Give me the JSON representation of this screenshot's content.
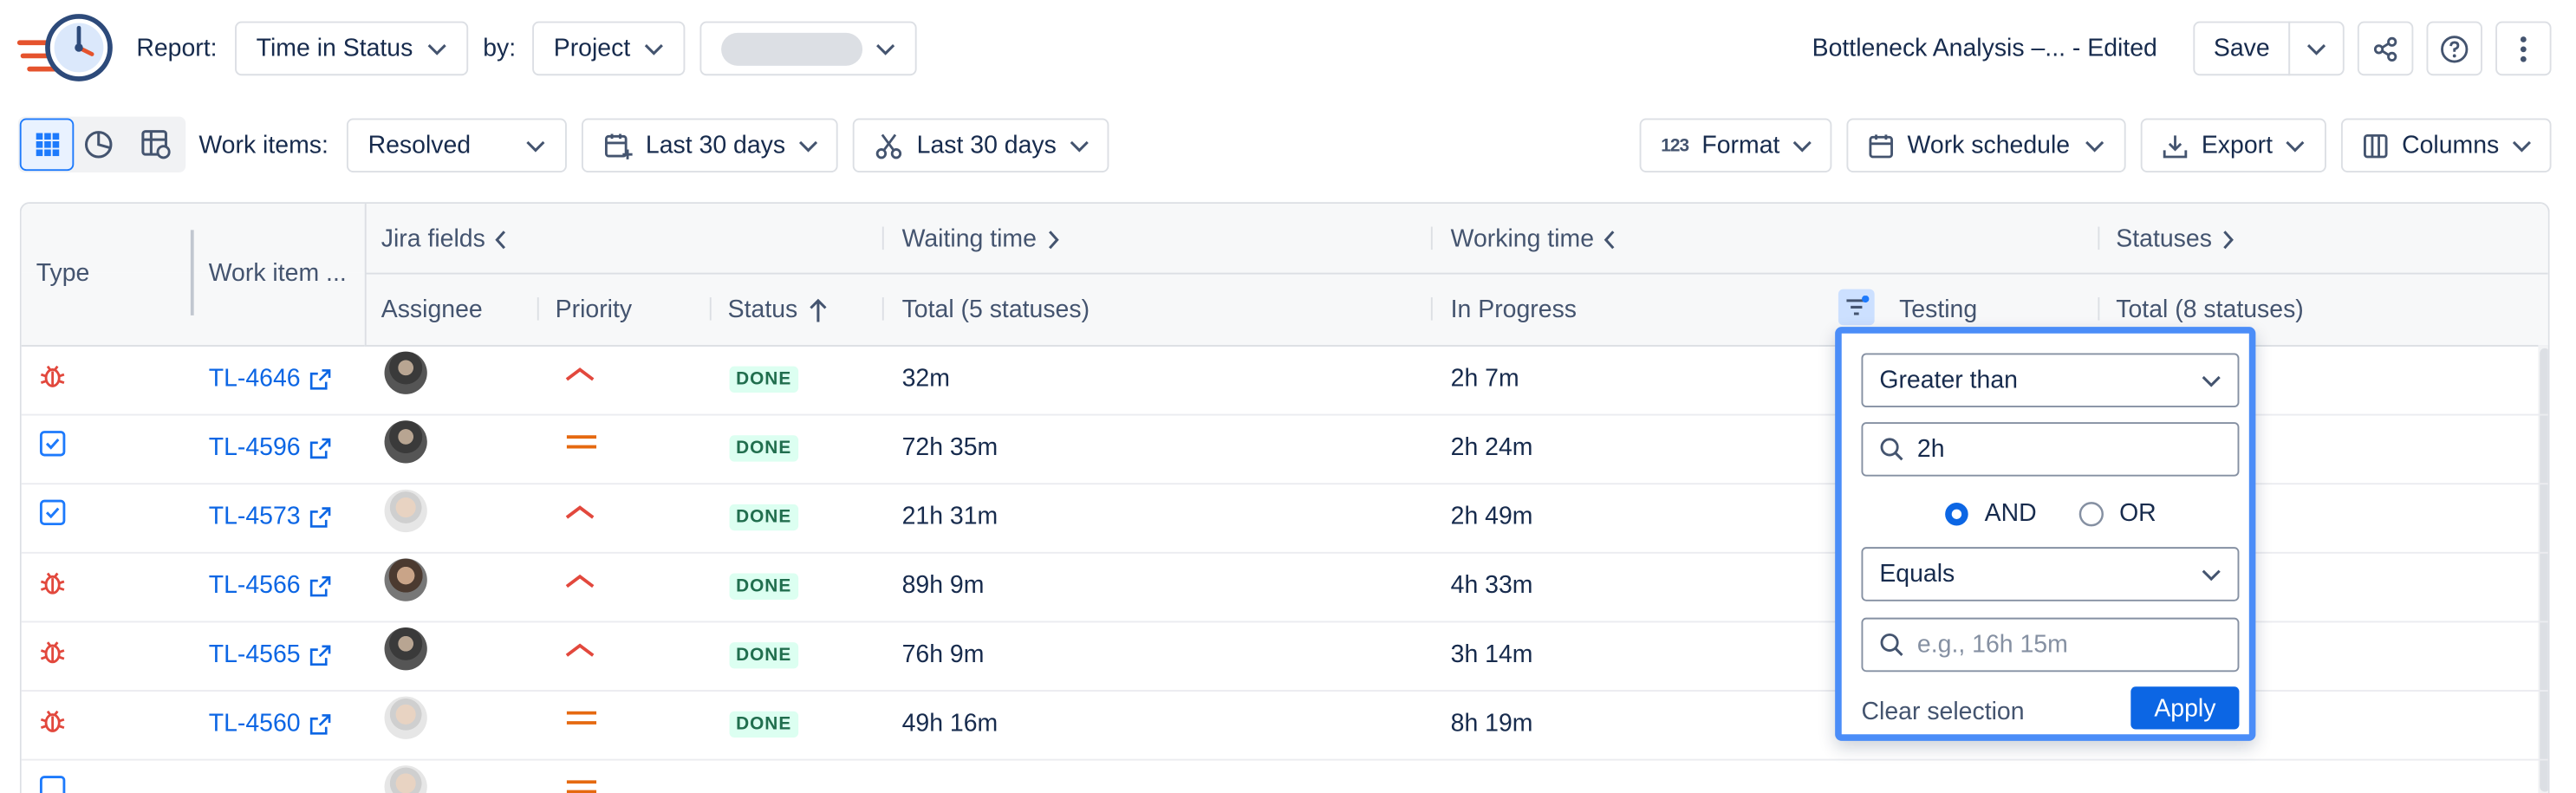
{
  "toolbar": {
    "report_label": "Report:",
    "report_value": "Time in Status",
    "by_label": "by:",
    "by_value": "Project",
    "report_name": "Bottleneck Analysis –... - Edited",
    "save_label": "Save"
  },
  "filters": {
    "work_items_label": "Work items:",
    "work_items_value": "Resolved",
    "date_range_1": "Last 30 days",
    "date_range_2": "Last 30 days",
    "format_label": "Format",
    "work_schedule_label": "Work schedule",
    "export_label": "Export",
    "columns_label": "Columns"
  },
  "table": {
    "groups": {
      "type": "Type",
      "work_item": "Work item ...",
      "jira_fields": "Jira fields",
      "waiting_time": "Waiting time",
      "working_time": "Working time",
      "statuses": "Statuses"
    },
    "columns": {
      "assignee": "Assignee",
      "priority": "Priority",
      "status": "Status",
      "waiting_total": "Total (5 statuses)",
      "in_progress": "In Progress",
      "testing": "Testing",
      "statuses_total": "Total (8 statuses)"
    },
    "rows": [
      {
        "type": "bug",
        "key": "TL-4646",
        "priority": "high",
        "status": "DONE",
        "waiting": "32m",
        "in_progress": "2h 7m"
      },
      {
        "type": "task",
        "key": "TL-4596",
        "priority": "medium",
        "status": "DONE",
        "waiting": "72h 35m",
        "in_progress": "2h 24m"
      },
      {
        "type": "task",
        "key": "TL-4573",
        "priority": "high",
        "status": "DONE",
        "waiting": "21h 31m",
        "in_progress": "2h 49m"
      },
      {
        "type": "bug",
        "key": "TL-4566",
        "priority": "high",
        "status": "DONE",
        "waiting": "89h 9m",
        "in_progress": "4h 33m"
      },
      {
        "type": "bug",
        "key": "TL-4565",
        "priority": "high",
        "status": "DONE",
        "waiting": "76h 9m",
        "in_progress": "3h 14m"
      },
      {
        "type": "bug",
        "key": "TL-4560",
        "priority": "medium",
        "status": "DONE",
        "waiting": "49h 16m",
        "in_progress": "8h 19m"
      }
    ]
  },
  "filter_popup": {
    "condition_1": "Greater than",
    "value_1": "2h",
    "logic_and": "AND",
    "logic_or": "OR",
    "selected_logic": "AND",
    "condition_2": "Equals",
    "value_2_placeholder": "e.g., 16h 15m",
    "clear_label": "Clear selection",
    "apply_label": "Apply"
  },
  "colors": {
    "accent": "#0c66e4",
    "popup_border": "#4b8df8",
    "bug": "#e2483d",
    "task": "#1d7afc",
    "priority_high": "#e2483d",
    "priority_medium": "#e56910",
    "done_bg": "#dcfff1",
    "done_text": "#216e4e"
  }
}
